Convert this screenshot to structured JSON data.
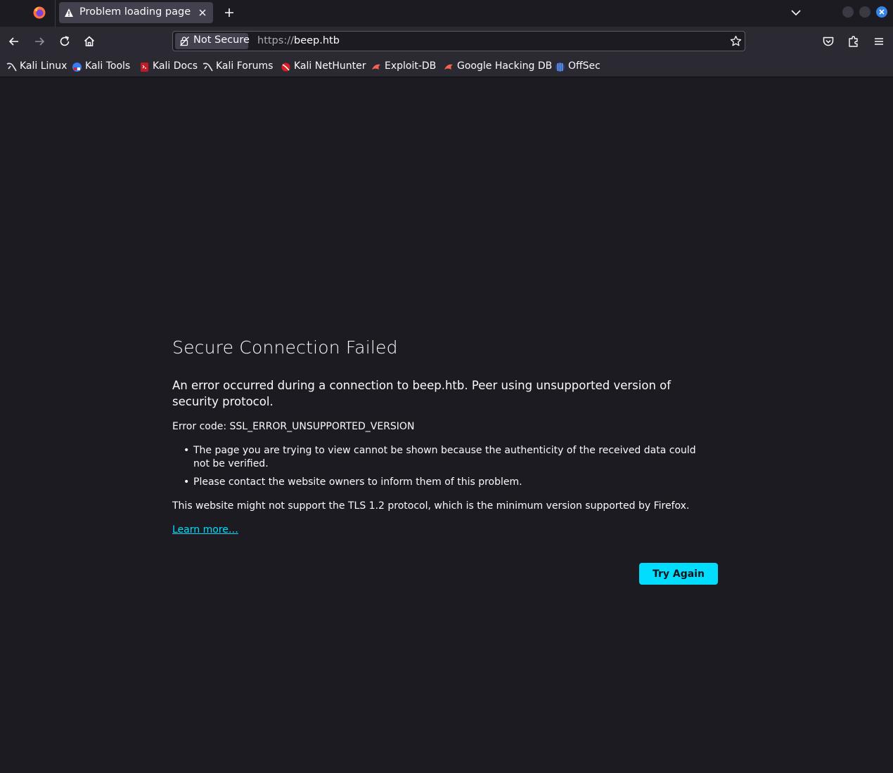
{
  "tab": {
    "title": "Problem loading page"
  },
  "urlbar": {
    "security_label": "Not Secure",
    "scheme": "https://",
    "host": "beep.htb"
  },
  "bookmarks": [
    {
      "label": "Kali Linux",
      "icon": "kali-dragon-icon"
    },
    {
      "label": "Kali Tools",
      "icon": "kali-tools-icon"
    },
    {
      "label": "Kali Docs",
      "icon": "kali-docs-icon"
    },
    {
      "label": "Kali Forums",
      "icon": "kali-dragon-icon"
    },
    {
      "label": "Kali NetHunter",
      "icon": "nethunter-icon"
    },
    {
      "label": "Exploit-DB",
      "icon": "exploit-db-icon"
    },
    {
      "label": "Google Hacking DB",
      "icon": "exploit-db-icon"
    },
    {
      "label": "OffSec",
      "icon": "offsec-icon"
    }
  ],
  "error": {
    "title": "Secure Connection Failed",
    "intro": "An error occurred during a connection to beep.htb. Peer using unsupported version of security protocol.",
    "code_line": "Error code: SSL_ERROR_UNSUPPORTED_VERSION",
    "reasons": [
      "The page you are trying to view cannot be shown because the authenticity of the received data could not be verified.",
      "Please contact the website owners to inform them of this problem."
    ],
    "tls_note": "This website might not support the TLS 1.2 protocol, which is the minimum version supported by Firefox.",
    "learn_more": "Learn more…",
    "try_again": "Try Again"
  },
  "colors": {
    "page_bg": "#1c1b22",
    "toolbar_bg": "#2b2a33",
    "accent": "#00ddff",
    "close_button": "#3584e4"
  }
}
